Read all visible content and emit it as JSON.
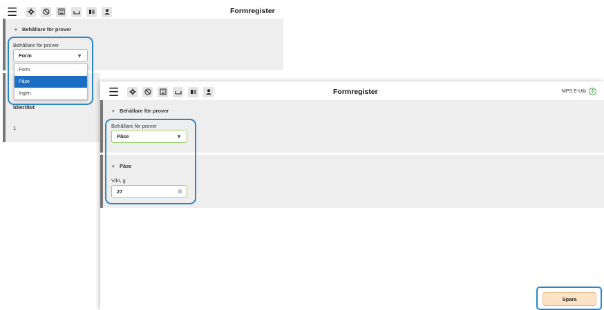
{
  "back_window": {
    "title": "Formregister",
    "section_title": "Behållare för prover",
    "field_label": "Behållare för prover",
    "select_value": "Form",
    "dropdown_options": [
      "Form",
      "Påse",
      "Ingen"
    ],
    "selected_option_index": 1,
    "column_header": "Identitet",
    "row_value": "1"
  },
  "front_window": {
    "title": "Formregister",
    "user_name": "MPS E-Utb",
    "section1_title": "Behållare för prover",
    "field_label": "Behållare för prover",
    "select_value": "Påse",
    "section2_title": "Påse",
    "weight_label": "Vikt, g",
    "weight_value": "27",
    "save_label": "Spara"
  },
  "toolbar_icons": [
    "gear-icon",
    "block-icon",
    "register-icon",
    "container-icon",
    "cards-icon",
    "person-icon"
  ],
  "colors": {
    "highlight": "#2a86c8",
    "selected_option": "#1a6fc4",
    "field_border": "#9ccf6a",
    "save_button": "#fde3c4"
  }
}
